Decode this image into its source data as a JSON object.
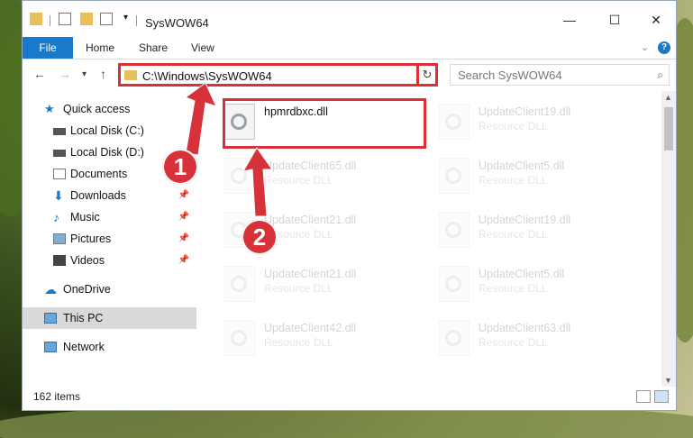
{
  "window": {
    "title": "SysWOW64",
    "controls": {
      "minimize": "—",
      "maximize": "☐",
      "close": "✕"
    }
  },
  "ribbon": {
    "tabs": [
      "File",
      "Home",
      "Share",
      "View"
    ]
  },
  "nav": {
    "address": "C:\\Windows\\SysWOW64",
    "search_placeholder": "Search SysWOW64"
  },
  "sidebar": {
    "items": [
      {
        "label": "Quick access",
        "icon": "star-icon",
        "pinned": false
      },
      {
        "label": "Local Disk (C:)",
        "icon": "drive-icon",
        "pinned": false
      },
      {
        "label": "Local Disk (D:)",
        "icon": "drive-icon",
        "pinned": false
      },
      {
        "label": "Documents",
        "icon": "documents-icon",
        "pinned": false
      },
      {
        "label": "Downloads",
        "icon": "downloads-icon",
        "pinned": true
      },
      {
        "label": "Music",
        "icon": "music-icon",
        "pinned": true
      },
      {
        "label": "Pictures",
        "icon": "pictures-icon",
        "pinned": true
      },
      {
        "label": "Videos",
        "icon": "videos-icon",
        "pinned": true
      },
      {
        "label": "OneDrive",
        "icon": "cloud-icon",
        "pinned": false
      },
      {
        "label": "This PC",
        "icon": "computer-icon",
        "pinned": false
      },
      {
        "label": "Network",
        "icon": "network-icon",
        "pinned": false
      }
    ]
  },
  "files": [
    {
      "name": "hpmrdbxc.dll",
      "type": ""
    },
    {
      "name": "UpdateClient19.dll",
      "type": "Resource DLL"
    },
    {
      "name": "UpdateClient65.dll",
      "type": "Resource DLL"
    },
    {
      "name": "UpdateClient5.dll",
      "type": "Resource DLL"
    },
    {
      "name": "UpdateClient21.dll",
      "type": "Resource DLL"
    },
    {
      "name": "UpdateClient19.dll",
      "type": "Resource DLL"
    },
    {
      "name": "UpdateClient21.dll",
      "type": "Resource DLL"
    },
    {
      "name": "UpdateClient5.dll",
      "type": "Resource DLL"
    },
    {
      "name": "UpdateClient42.dll",
      "type": "Resource DLL"
    },
    {
      "name": "UpdateClient63.dll",
      "type": "Resource DLL"
    }
  ],
  "status": {
    "item_count": "162 items"
  },
  "callouts": [
    "1",
    "2"
  ],
  "colors": {
    "accent": "#1979ca",
    "highlight": "#d7323a"
  }
}
